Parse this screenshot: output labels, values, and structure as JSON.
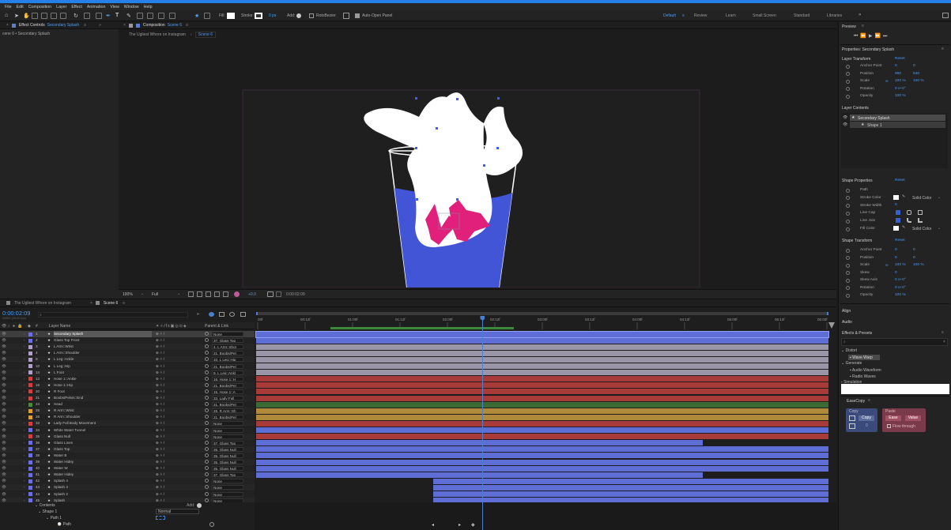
{
  "menu": [
    "File",
    "Edit",
    "Composition",
    "Layer",
    "Effect",
    "Animation",
    "View",
    "Window",
    "Help"
  ],
  "toolbar": {
    "fill_label": "Fill:",
    "stroke_label": "Stroke:",
    "stroke_width": "0 px",
    "add_label": "Add:",
    "rotobezier": "RotoBezier",
    "auto_open": "Auto-Open Panel"
  },
  "workspaces": [
    "Default",
    "Review",
    "Learn",
    "Small Screen",
    "Standard",
    "Libraries"
  ],
  "left_panel": {
    "tab": "Effect Controls",
    "tab_target": "Secondary Splash",
    "path": "cene 6 • Secondary Splash"
  },
  "comp": {
    "tab": "Composition",
    "tab_target": "Scene 6",
    "crumb1": "The Ugliest Whore on Instagram",
    "crumb2": "Scene 6",
    "zoom": "100%",
    "resolution": "Full",
    "exposure": "+0.0",
    "time": "0:00:02:09"
  },
  "timeline": {
    "tabs": [
      "The Ugliest Whore on Instagram",
      "Scene 6"
    ],
    "timecode": "0:00:02:09",
    "fps": "00069 (25.00 fps)",
    "col_layer": "Layer Name",
    "col_parent": "Parent & Link",
    "col_num": "#",
    "ruler": [
      "00f",
      "00:12f",
      "01:00f",
      "01:12f",
      "02:00f",
      "02:12f",
      "03:00f",
      "03:12f",
      "04:00f",
      "04:12f",
      "05:00f",
      "05:12f",
      "06:00f"
    ],
    "layers": [
      {
        "n": "1",
        "name": "Secondary Splash",
        "parent": "None",
        "color": "#6e6ee0",
        "bar": "#5f6dd6",
        "start": 0,
        "end": 1
      },
      {
        "n": "2",
        "name": "Glass Top Front",
        "parent": "37. Glass Top",
        "color": "#6e6ee0",
        "bar": "#5f6dd6",
        "start": 0,
        "end": 1
      },
      {
        "n": "3",
        "name": "L Arm::Wrist",
        "parent": "4. L Arm::Shor",
        "color": "#b0a0c8",
        "bar": "#9a96a8",
        "start": 0,
        "end": 1
      },
      {
        "n": "4",
        "name": "L Arm::Shoulder",
        "parent": "21. Boobs/Pel",
        "color": "#b0a0c8",
        "bar": "#9a96a8",
        "start": 0,
        "end": 1
      },
      {
        "n": "9",
        "name": "L Leg::Ankle",
        "parent": "10. L Leg::Hip",
        "color": "#b0a0c8",
        "bar": "#9a96a8",
        "start": 0,
        "end": 1
      },
      {
        "n": "10",
        "name": "L Leg::Hip",
        "parent": "21. Boobs/Pel",
        "color": "#b0a0c8",
        "bar": "#9a96a8",
        "start": 0,
        "end": 1
      },
      {
        "n": "14",
        "name": "L Foot",
        "parent": "9. L Leg::Ankl",
        "color": "#b0a0c8",
        "bar": "#9a96a8",
        "start": 0,
        "end": 1
      },
      {
        "n": "13",
        "name": "Hose 1::Ankle",
        "parent": "16. Hose 1::H",
        "color": "#d04040",
        "bar": "#a83a3a",
        "start": 0,
        "end": 1
      },
      {
        "n": "16",
        "name": "Hose 1::Hip",
        "parent": "21. Boobs/Pel",
        "color": "#d04040",
        "bar": "#a83a3a",
        "start": 0,
        "end": 1
      },
      {
        "n": "20",
        "name": "R Foot",
        "parent": "15. Hose 1::A",
        "color": "#d04040",
        "bar": "#a83a3a",
        "start": 0,
        "end": 1
      },
      {
        "n": "21",
        "name": "Boobs/Pelvis::End",
        "parent": "33. Lady Full",
        "color": "#d04040",
        "bar": "#a83a3a",
        "start": 0,
        "end": 1
      },
      {
        "n": "24",
        "name": "Head",
        "parent": "21. Boobs/Pel",
        "color": "#4a8a3a",
        "bar": "#3c6a34",
        "start": 0,
        "end": 1
      },
      {
        "n": "25",
        "name": "R Arm::Wrist",
        "parent": "26. R Arm::Sh",
        "color": "#e0a030",
        "bar": "#b08a3a",
        "start": 0,
        "end": 1
      },
      {
        "n": "26",
        "name": "R Arm::Shoulder",
        "parent": "21. Boobs/Pel",
        "color": "#e0a030",
        "bar": "#b08a3a",
        "start": 0,
        "end": 1
      },
      {
        "n": "33",
        "name": "Lady Full Body Movement",
        "parent": "None",
        "color": "#d04040",
        "bar": "#a83a3a",
        "start": 0,
        "end": 1
      },
      {
        "n": "34",
        "name": "White Water Tunnel",
        "parent": "None",
        "color": "#6e6ee0",
        "bar": "#5f6dd6",
        "start": 0,
        "end": 1
      },
      {
        "n": "35",
        "name": "Glass Null",
        "parent": "None",
        "color": "#d04040",
        "bar": "#a83a3a",
        "start": 0,
        "end": 1
      },
      {
        "n": "36",
        "name": "Glass Lines",
        "parent": "37. Glass Top",
        "color": "#6e6ee0",
        "bar": "#5f6dd6",
        "start": 0,
        "end": 0.78
      },
      {
        "n": "37",
        "name": "Glass Top",
        "parent": "35. Glass Null",
        "color": "#6e6ee0",
        "bar": "#5f6dd6",
        "start": 0,
        "end": 1
      },
      {
        "n": "38",
        "name": "Water B",
        "parent": "35. Glass Null",
        "color": "#6e6ee0",
        "bar": "#5f6dd6",
        "start": 0,
        "end": 1
      },
      {
        "n": "39",
        "name": "Water Hidey",
        "parent": "35. Glass Null",
        "color": "#6e6ee0",
        "bar": "#5f6dd6",
        "start": 0,
        "end": 1
      },
      {
        "n": "40",
        "name": "Water W",
        "parent": "35. Glass Null",
        "color": "#6e6ee0",
        "bar": "#5f6dd6",
        "start": 0,
        "end": 1
      },
      {
        "n": "41",
        "name": "Water Hidey",
        "parent": "37. Glass Top",
        "color": "#6e6ee0",
        "bar": "#5f6dd6",
        "start": 0,
        "end": 0.78
      },
      {
        "n": "42",
        "name": "Splash 4",
        "parent": "None",
        "color": "#6e6ee0",
        "bar": "#5f6dd6",
        "start": 0.31,
        "end": 1
      },
      {
        "n": "43",
        "name": "Splash 3",
        "parent": "None",
        "color": "#6e6ee0",
        "bar": "#5f6dd6",
        "start": 0.31,
        "end": 1
      },
      {
        "n": "44",
        "name": "Splash 2",
        "parent": "None",
        "color": "#6e6ee0",
        "bar": "#5f6dd6",
        "start": 0.31,
        "end": 1
      },
      {
        "n": "45",
        "name": "Splash",
        "parent": "None",
        "color": "#6e6ee0",
        "bar": "#5f6dd6",
        "start": 0.31,
        "end": 1
      }
    ],
    "contents": "Contents",
    "shape1": "Shape 1",
    "path1": "Path 1",
    "path": "Path",
    "mode": "Normal",
    "add": "Add:",
    "playhead": 0.395,
    "work_area": [
      0.13,
      0.45
    ]
  },
  "right": {
    "preview": "Preview",
    "properties_title": "Properties: Secondary Splash",
    "layer_transform": "Layer Transform",
    "reset": "Reset",
    "lt_rows": [
      {
        "label": "Anchor Point",
        "v1": "0",
        "v2": "0"
      },
      {
        "label": "Position",
        "v1": "960",
        "v2": "540"
      },
      {
        "label": "Scale",
        "v1": "100 %",
        "v2": "100 %"
      },
      {
        "label": "Rotation",
        "v1": "0 x+0°",
        "v2": ""
      },
      {
        "label": "Opacity",
        "v1": "100 %",
        "v2": ""
      }
    ],
    "layer_contents": "Layer Contents",
    "lc_item1": "Secondary Splash",
    "lc_item2": "Shape 1",
    "shape_properties": "Shape Properties",
    "sp_rows": [
      "Path",
      "Stroke Color",
      "Stroke Width",
      "Line Cap",
      "Line Join",
      "Fill Color"
    ],
    "stroke_width_val": "0",
    "solid_color": "Solid Color",
    "shape_transform": "Shape Transform",
    "st_rows": [
      {
        "label": "Anchor Point",
        "v1": "0",
        "v2": "0"
      },
      {
        "label": "Position",
        "v1": "0",
        "v2": "0"
      },
      {
        "label": "Scale",
        "v1": "100 %",
        "v2": "100 %"
      },
      {
        "label": "Skew",
        "v1": "0",
        "v2": ""
      },
      {
        "label": "Skew Axis",
        "v1": "0 x+0°",
        "v2": ""
      },
      {
        "label": "Rotation",
        "v1": "0 x+0°",
        "v2": ""
      },
      {
        "label": "Opacity",
        "v1": "100 %",
        "v2": ""
      }
    ],
    "align": "Align",
    "audio": "Audio",
    "effects_presets": "Effects & Presets",
    "ep_distort": "Distort",
    "ep_wave": "Wave Warp",
    "ep_generate": "Generate",
    "ep_audio_wave": "Audio Waveform",
    "ep_audio_spec": "Radio Waves",
    "ep_simulation": "Simulation",
    "easecopy": "EaseCopy",
    "ec_copy_group": "Copy",
    "ec_copy_btn": "Copy",
    "ec_paste_group": "Paste",
    "ec_ease": "Ease",
    "ec_value": "Value",
    "ec_flowthrough": "Flow through",
    "ec_num": "0"
  }
}
